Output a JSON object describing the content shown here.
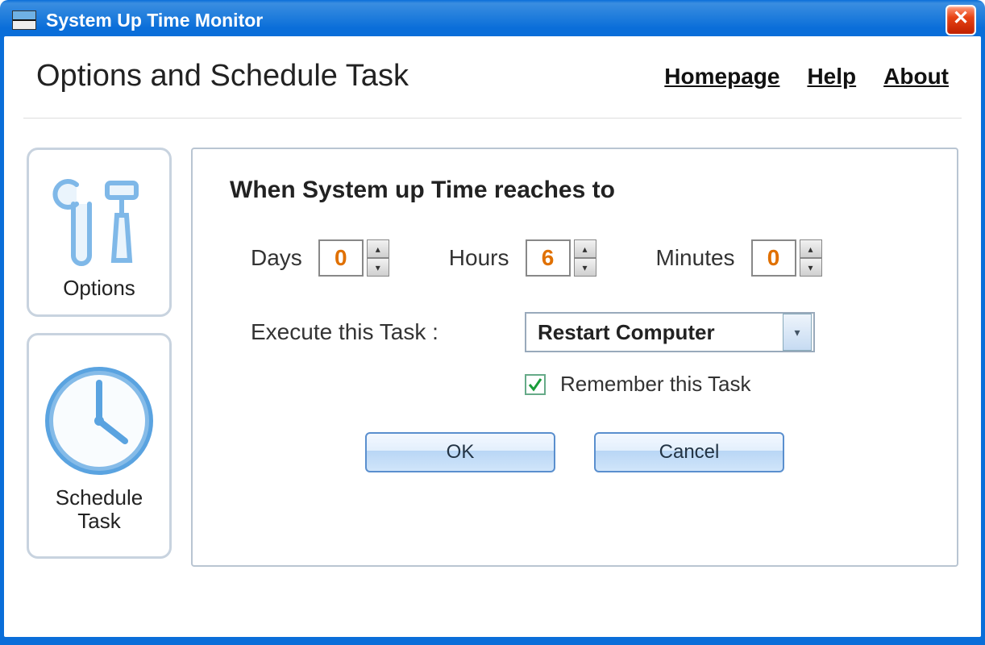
{
  "window": {
    "title": "System Up Time Monitor"
  },
  "header": {
    "title": "Options and Schedule Task",
    "links": {
      "homepage": "Homepage",
      "help": "Help",
      "about": "About"
    }
  },
  "sidebar": {
    "options_label": "Options",
    "schedule_label": "Schedule Task"
  },
  "panel": {
    "heading": "When System up Time reaches to",
    "days_label": "Days",
    "hours_label": "Hours",
    "minutes_label": "Minutes",
    "days_value": "0",
    "hours_value": "6",
    "minutes_value": "0",
    "task_label": "Execute this Task :",
    "task_selected": "Restart Computer",
    "remember_label": "Remember this Task",
    "remember_checked": true,
    "ok_label": "OK",
    "cancel_label": "Cancel"
  }
}
